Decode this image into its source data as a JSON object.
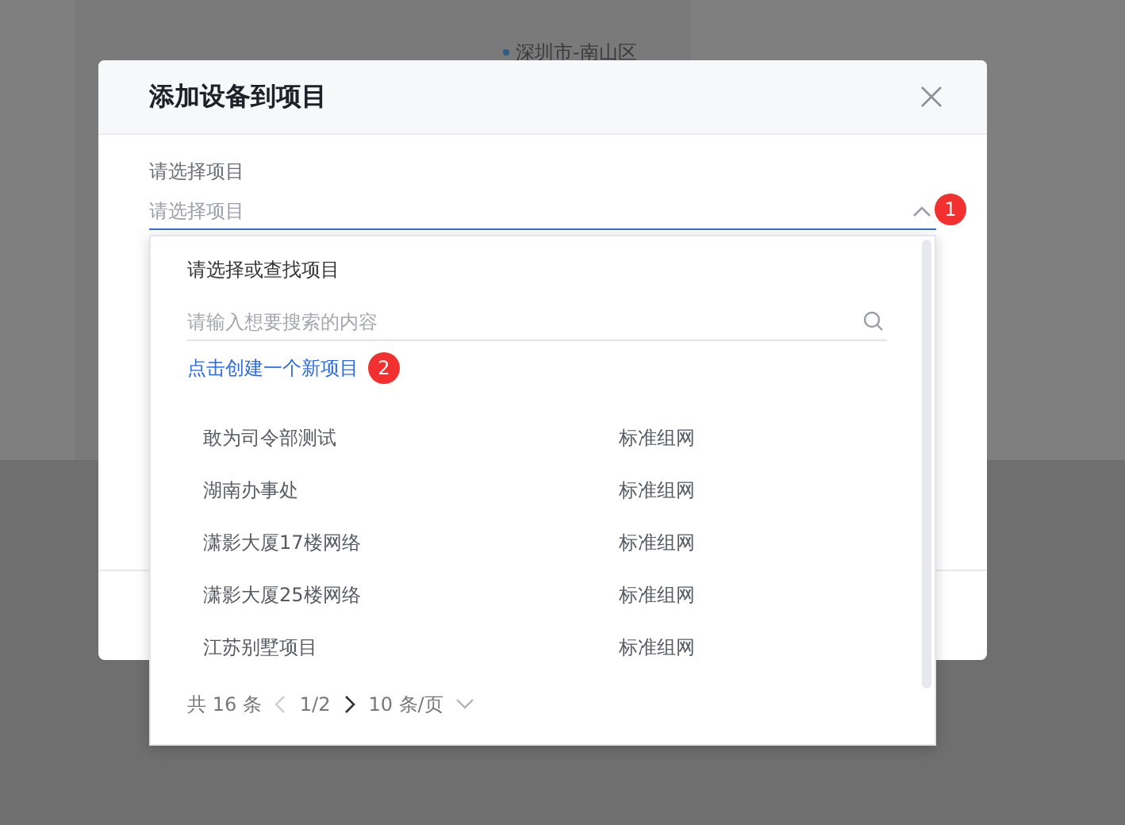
{
  "background": {
    "region_label": "深圳市-南山区"
  },
  "dialog": {
    "title": "添加设备到项目",
    "field_label": "请选择项目",
    "select": {
      "placeholder": "请选择项目",
      "expanded": true,
      "callout": "1"
    },
    "dropdown": {
      "heading": "请选择或查找项目",
      "search": {
        "placeholder": "请输入想要搜索的内容"
      },
      "create_link": {
        "label": "点击创建一个新项目",
        "callout": "2"
      },
      "projects": [
        {
          "name": "敢为司令部测试",
          "type": "标准组网"
        },
        {
          "name": "湖南办事处",
          "type": "标准组网"
        },
        {
          "name": "潇影大厦17楼网络",
          "type": "标准组网"
        },
        {
          "name": "潇影大厦25楼网络",
          "type": "标准组网"
        },
        {
          "name": "江苏别墅项目",
          "type": "标准组网"
        }
      ],
      "pagination": {
        "total": "共 16 条",
        "prev_disabled": true,
        "page": "1/2",
        "next_disabled": false,
        "page_size": "10 条/页"
      }
    }
  }
}
